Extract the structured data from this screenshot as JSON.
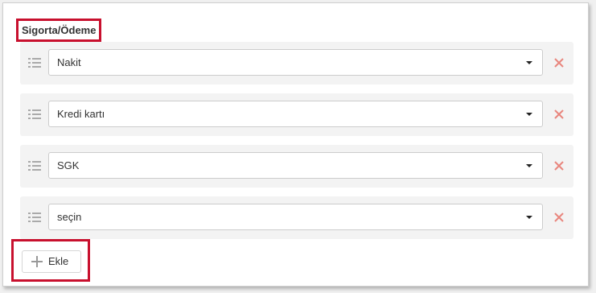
{
  "section": {
    "title": "Sigorta/Ödeme"
  },
  "rows": [
    {
      "value": "Nakit"
    },
    {
      "value": "Kredi kartı"
    },
    {
      "value": "SGK"
    },
    {
      "value": "seçin"
    }
  ],
  "add_button": {
    "label": "Ekle"
  },
  "icons": {
    "drag": "list-drag-icon",
    "caret": "caret-down-icon",
    "remove": "close-icon",
    "add": "plus-icon"
  },
  "colors": {
    "highlight": "#c8102e",
    "remove_icon": "#e8867d",
    "row_background": "#f3f3f3"
  }
}
